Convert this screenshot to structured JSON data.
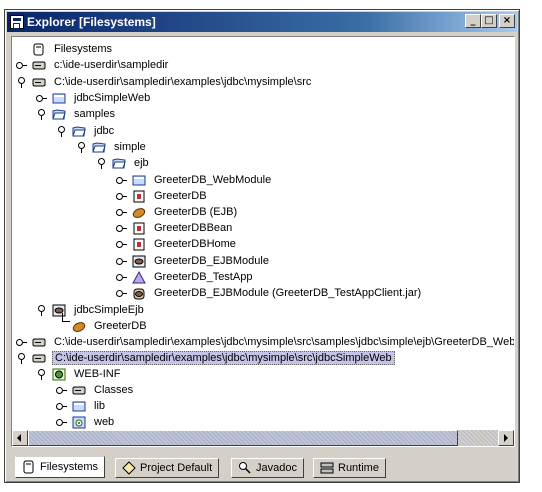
{
  "window": {
    "title": "Explorer [Filesystems]",
    "controls": {
      "minimize": "_",
      "maximize": "□",
      "close": "×"
    }
  },
  "tree": [
    {
      "label": "Filesystems",
      "icon": "filesystems-icon",
      "handle": "none"
    },
    {
      "label": "c:\\ide-userdir\\sampledir",
      "icon": "drive-icon",
      "handle": "collapsed"
    },
    {
      "label": "C:\\ide-userdir\\sampledir\\examples\\jdbc\\mysimple\\src",
      "icon": "drive-icon",
      "handle": "expanded"
    },
    {
      "label": "jdbcSimpleWeb",
      "icon": "folder-icon",
      "handle": "collapsed"
    },
    {
      "label": "samples",
      "icon": "folder-open-icon",
      "handle": "expanded"
    },
    {
      "label": "jdbc",
      "icon": "folder-open-icon",
      "handle": "expanded"
    },
    {
      "label": "simple",
      "icon": "folder-open-icon",
      "handle": "expanded"
    },
    {
      "label": "ejb",
      "icon": "folder-open-icon",
      "handle": "expanded"
    },
    {
      "label": "GreeterDB_WebModule",
      "icon": "folder-icon",
      "handle": "collapsed"
    },
    {
      "label": "GreeterDB",
      "icon": "java-class-icon",
      "handle": "collapsed"
    },
    {
      "label": "GreeterDB (EJB)",
      "icon": "ejb-bean-icon",
      "handle": "collapsed"
    },
    {
      "label": "GreeterDBBean",
      "icon": "java-class-icon",
      "handle": "collapsed"
    },
    {
      "label": "GreeterDBHome",
      "icon": "java-class-icon",
      "handle": "collapsed"
    },
    {
      "label": "GreeterDB_EJBModule",
      "icon": "ejb-module-icon",
      "handle": "collapsed"
    },
    {
      "label": "GreeterDB_TestApp",
      "icon": "application-icon",
      "handle": "collapsed"
    },
    {
      "label": "GreeterDB_EJBModule (GreeterDB_TestAppClient.jar)",
      "icon": "jar-bean-icon",
      "handle": "collapsed"
    },
    {
      "label": "jdbcSimpleEjb",
      "icon": "ejb-module-icon",
      "handle": "expanded"
    },
    {
      "label": "GreeterDB",
      "icon": "ejb-bean-icon",
      "handle": "none"
    },
    {
      "label": "C:\\ide-userdir\\sampledir\\examples\\jdbc\\mysimple\\src\\samples\\jdbc\\simple\\ejb\\GreeterDB_WebModule",
      "icon": "drive-icon",
      "handle": "collapsed"
    },
    {
      "label": "C:\\ide-userdir\\sampledir\\examples\\jdbc\\mysimple\\src\\jdbcSimpleWeb",
      "icon": "drive-icon",
      "handle": "expanded",
      "selected": true
    },
    {
      "label": "WEB-INF",
      "icon": "web-inf-icon",
      "handle": "expanded"
    },
    {
      "label": "Classes",
      "icon": "drive-icon",
      "handle": "collapsed"
    },
    {
      "label": "lib",
      "icon": "folder-icon",
      "handle": "collapsed"
    },
    {
      "label": "web",
      "icon": "web-folder-icon",
      "handle": "collapsed"
    }
  ],
  "tabs": [
    {
      "label": "Filesystems",
      "icon": "filesystems-icon",
      "active": true
    },
    {
      "label": "Project Default",
      "icon": "project-icon",
      "active": false
    },
    {
      "label": "Javadoc",
      "icon": "javadoc-icon",
      "active": false
    },
    {
      "label": "Runtime",
      "icon": "runtime-icon",
      "active": false
    }
  ],
  "colors": {
    "title_gradient_start": "#0a246a",
    "title_gradient_end": "#a6caf0",
    "selection": "#c4c4e8",
    "chrome": "#d4d0c8"
  }
}
